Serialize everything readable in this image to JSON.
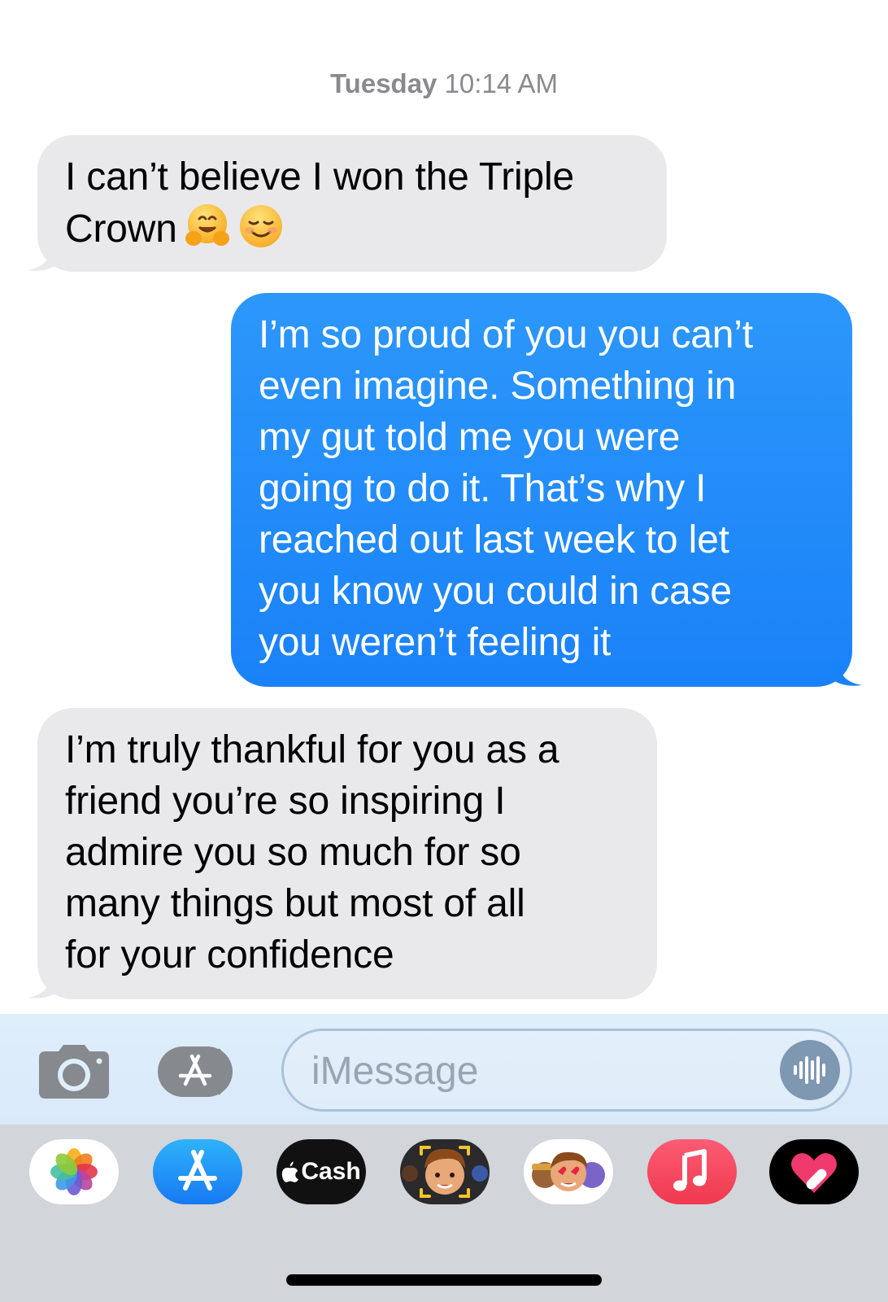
{
  "thread": {
    "timestamp_day": "Tuesday",
    "timestamp_time": "10:14 AM",
    "messages": [
      {
        "direction": "received",
        "text": "I can’t believe I won the Triple\nCrown",
        "emojis": [
          "hugging-face",
          "smiling-face"
        ]
      },
      {
        "direction": "sent",
        "text": "I’m so proud of you you can’t\neven imagine. Something in\nmy gut told me you were\ngoing to do it. That’s why I\nreached out last week to let\nyou know you could in case\nyou weren’t feeling it"
      },
      {
        "direction": "received",
        "text": "I’m truly thankful for you as a\nfriend you’re so inspiring I\nadmire you so much for so\nmany things but most of all\nfor your confidence"
      }
    ]
  },
  "composer": {
    "placeholder": "iMessage",
    "camera_icon": "camera-icon",
    "apps_icon": "app-store-icon",
    "mic_icon": "waveform-icon"
  },
  "app_drawer": {
    "apps": [
      {
        "name": "Photos",
        "icon": "photos-icon"
      },
      {
        "name": "App Store",
        "icon": "app-store-icon"
      },
      {
        "name": "Apple Cash",
        "label": "Cash",
        "icon": "apple-logo-icon"
      },
      {
        "name": "Memoji",
        "icon": "memoji-icon"
      },
      {
        "name": "Memoji Stickers",
        "icon": "memoji-stickers-icon"
      },
      {
        "name": "Music",
        "icon": "music-note-icon"
      },
      {
        "name": "Digital Touch",
        "icon": "heart-touch-icon"
      }
    ]
  },
  "colors": {
    "sent_bubble": "#1a82f8",
    "received_bubble": "#e9e9eb",
    "timestamp": "#8a8a8e",
    "drawer_bg": "#d2d5da",
    "music_red": "#f64a5b"
  }
}
